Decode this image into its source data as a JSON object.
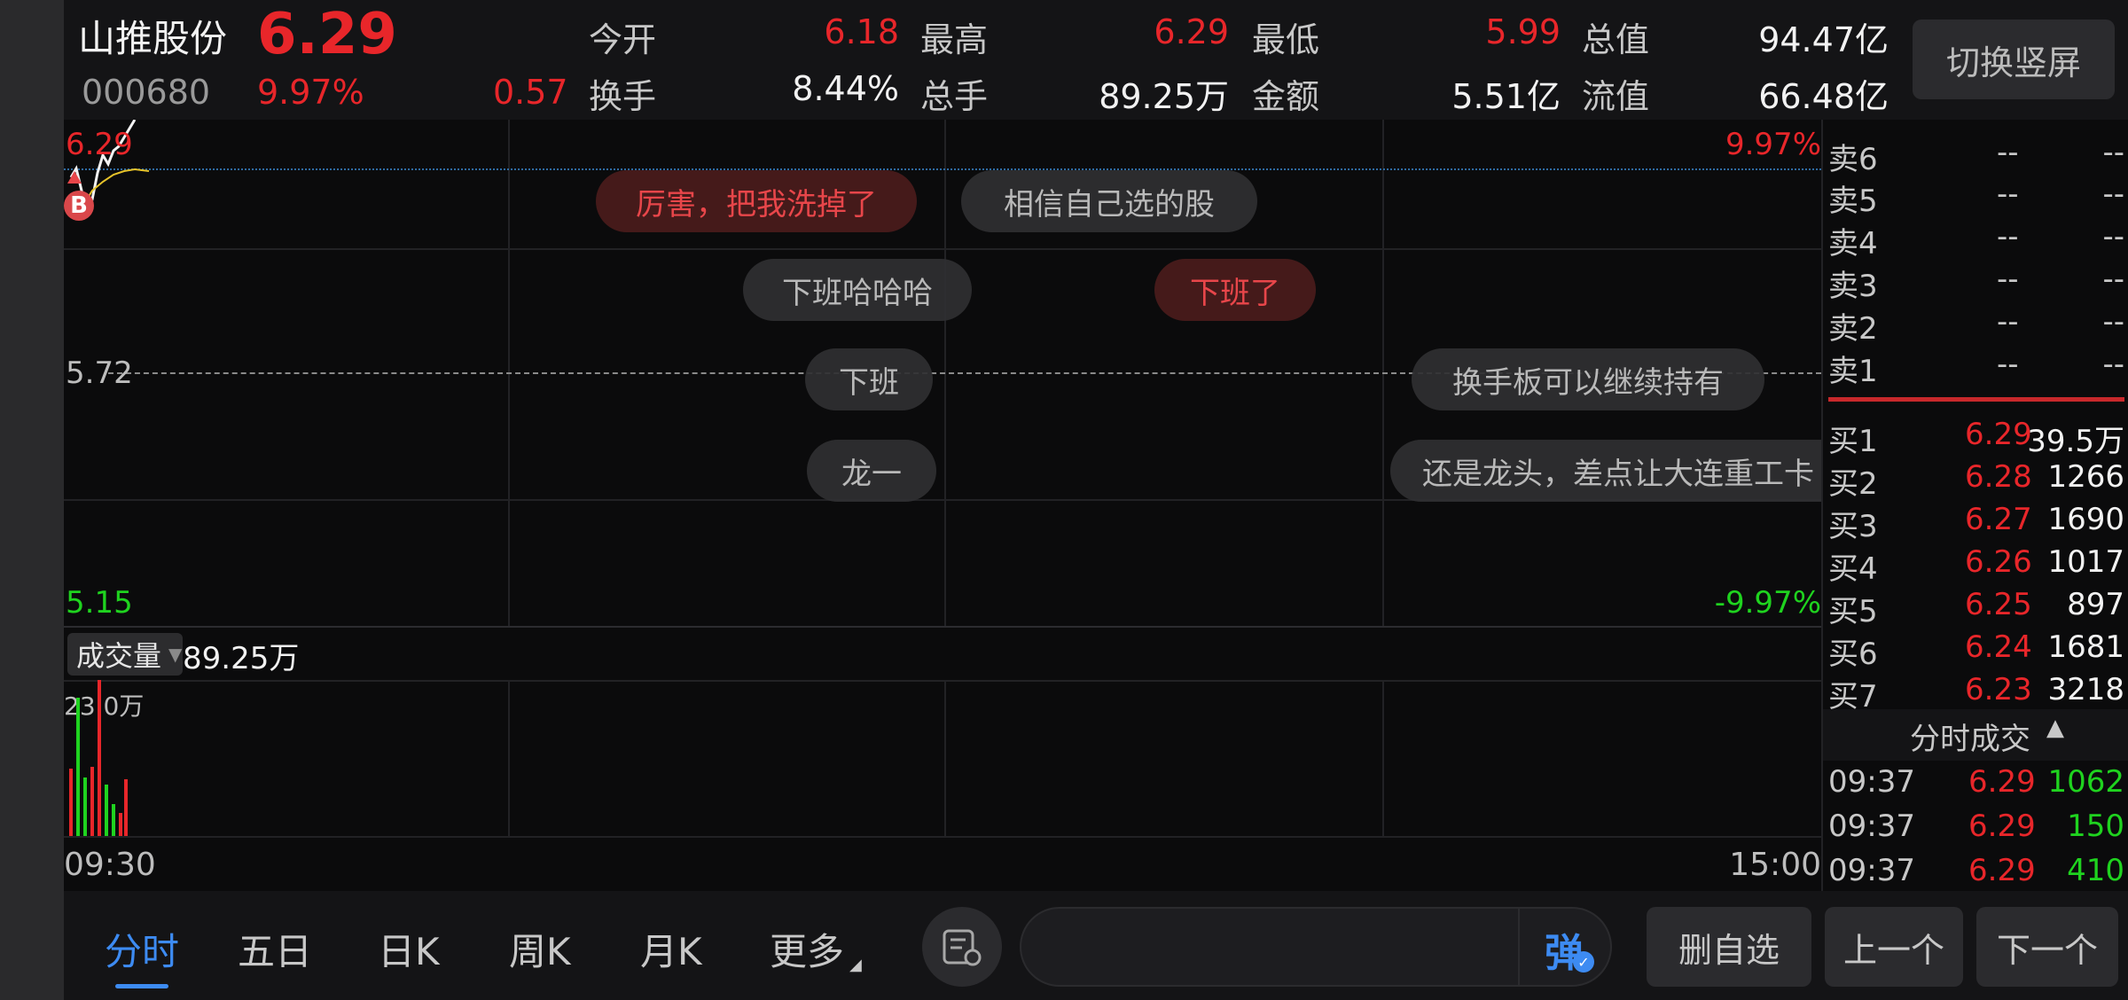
{
  "header": {
    "name": "山推股份",
    "price": "6.29",
    "code": "000680",
    "change_pct": "9.97%",
    "change_amt": "0.57",
    "stats": [
      {
        "label": "今开",
        "value": "6.18",
        "color": "red"
      },
      {
        "label": "最高",
        "value": "6.29",
        "color": "red"
      },
      {
        "label": "最低",
        "value": "5.99",
        "color": "red"
      },
      {
        "label": "总值",
        "value": "94.47亿",
        "color": "white"
      },
      {
        "label": "换手",
        "value": "8.44%",
        "color": "white"
      },
      {
        "label": "总手",
        "value": "89.25万",
        "color": "white"
      },
      {
        "label": "金额",
        "value": "5.51亿",
        "color": "white"
      },
      {
        "label": "流值",
        "value": "66.48亿",
        "color": "white"
      }
    ],
    "switch_button": "切换竖屏"
  },
  "chart": {
    "top_price": "6.29",
    "mid_price": "5.72",
    "bottom_price": "5.15",
    "top_pct": "9.97%",
    "bottom_pct": "-9.97%",
    "buy_marker": "B",
    "volume_label": "成交量",
    "volume_total": "89.25万",
    "volume_max": "23.0万",
    "time_start": "09:30",
    "time_end": "15:00"
  },
  "danmaku": [
    {
      "text": "厉害，把我洗掉了",
      "hot": true
    },
    {
      "text": "相信自己选的股",
      "hot": false
    },
    {
      "text": "下班哈哈哈",
      "hot": false
    },
    {
      "text": "下班了",
      "hot": true
    },
    {
      "text": "下班",
      "hot": false
    },
    {
      "text": "换手板可以继续持有",
      "hot": false
    },
    {
      "text": "龙一",
      "hot": false
    },
    {
      "text": "还是龙头，差点让大连重工卡",
      "hot": false
    }
  ],
  "orderbook": {
    "sell": [
      {
        "label": "卖6",
        "price": "--",
        "vol": "--"
      },
      {
        "label": "卖5",
        "price": "--",
        "vol": "--"
      },
      {
        "label": "卖4",
        "price": "--",
        "vol": "--"
      },
      {
        "label": "卖3",
        "price": "--",
        "vol": "--"
      },
      {
        "label": "卖2",
        "price": "--",
        "vol": "--"
      },
      {
        "label": "卖1",
        "price": "--",
        "vol": "--"
      }
    ],
    "buy": [
      {
        "label": "买1",
        "price": "6.29",
        "vol": "39.5万"
      },
      {
        "label": "买2",
        "price": "6.28",
        "vol": "1266"
      },
      {
        "label": "买3",
        "price": "6.27",
        "vol": "1690"
      },
      {
        "label": "买4",
        "price": "6.26",
        "vol": "1017"
      },
      {
        "label": "买5",
        "price": "6.25",
        "vol": "897"
      },
      {
        "label": "买6",
        "price": "6.24",
        "vol": "1681"
      },
      {
        "label": "买7",
        "price": "6.23",
        "vol": "3218"
      }
    ],
    "ticks_title": "分时成交",
    "ticks": [
      {
        "time": "09:37",
        "price": "6.29",
        "vol": "1062"
      },
      {
        "time": "09:37",
        "price": "6.29",
        "vol": "150"
      },
      {
        "time": "09:37",
        "price": "6.29",
        "vol": "410"
      }
    ]
  },
  "bottom": {
    "tabs": [
      "分时",
      "五日",
      "日K",
      "周K",
      "月K",
      "更多"
    ],
    "danmu_toggle": "弹",
    "danmu_input_placeholder": "",
    "remove_watch": "删自选",
    "prev": "上一个",
    "next": "下一个"
  },
  "colors": {
    "up": "#e8262a",
    "down": "#1fd31f",
    "accent": "#3d8bf2"
  }
}
